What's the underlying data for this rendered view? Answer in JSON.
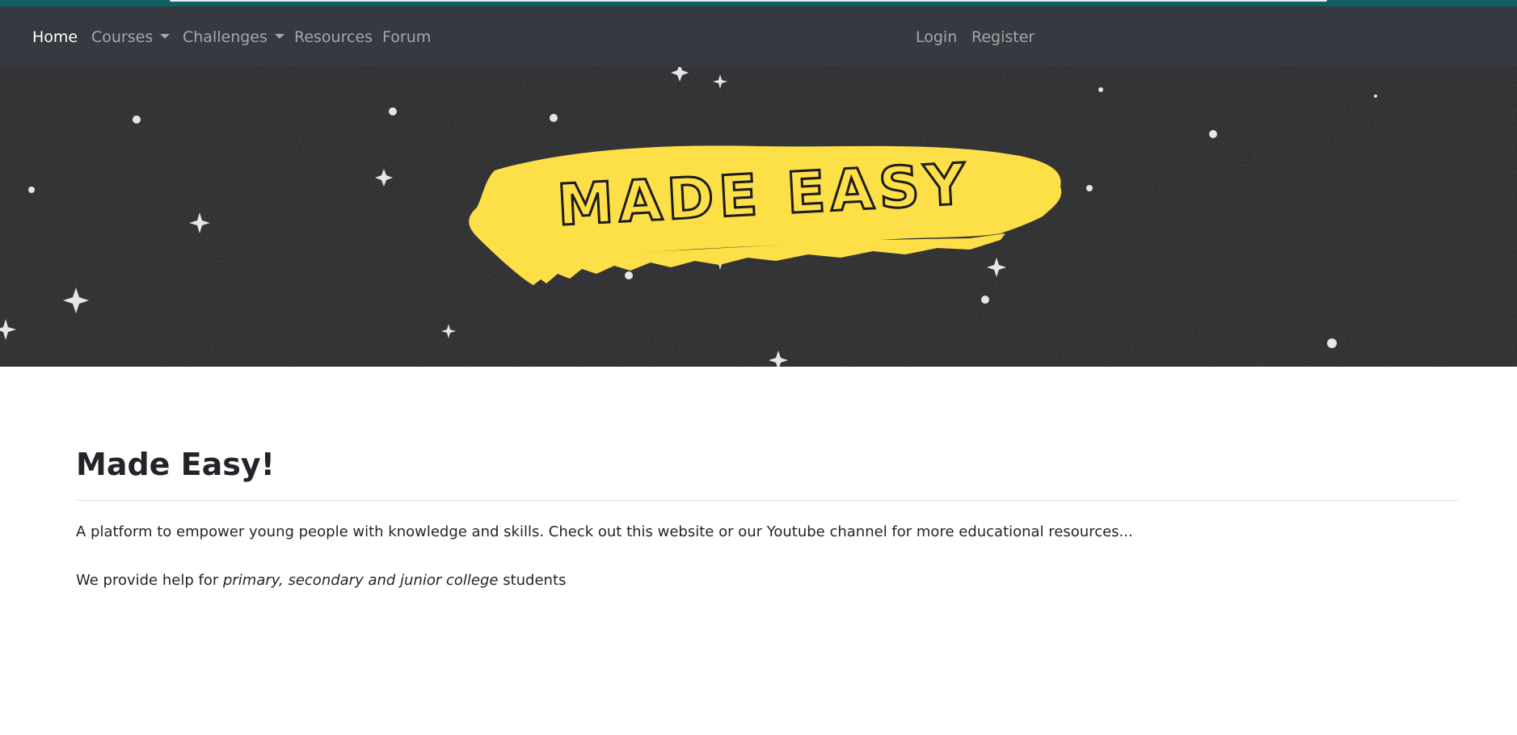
{
  "nav": {
    "left_items": [
      {
        "label": "Home",
        "active": true,
        "dropdown": false
      },
      {
        "label": "Courses",
        "active": false,
        "dropdown": true
      },
      {
        "label": "Challenges",
        "active": false,
        "dropdown": true
      },
      {
        "label": "Resources",
        "active": false,
        "dropdown": false
      },
      {
        "label": "Forum",
        "active": false,
        "dropdown": false
      }
    ],
    "right_items": [
      {
        "label": "Login"
      },
      {
        "label": "Register"
      }
    ]
  },
  "banner": {
    "logo_text": "MADE EASY",
    "brush_color": "#fde047",
    "background_color": "#1b1b1d"
  },
  "main": {
    "title": "Made Easy!",
    "paragraph_1": "A platform to empower young people with knowledge and skills. Check out this website or our Youtube channel for more educational resources...",
    "paragraph_2_prefix": "We provide help for ",
    "paragraph_2_emphasis": "primary, secondary and junior college",
    "paragraph_2_suffix": " students"
  },
  "colors": {
    "navbar": "#343a40",
    "top_strip": "#0f5f63",
    "nav_active": "#ffffff",
    "nav_inactive": "rgba(255,255,255,0.55)"
  }
}
